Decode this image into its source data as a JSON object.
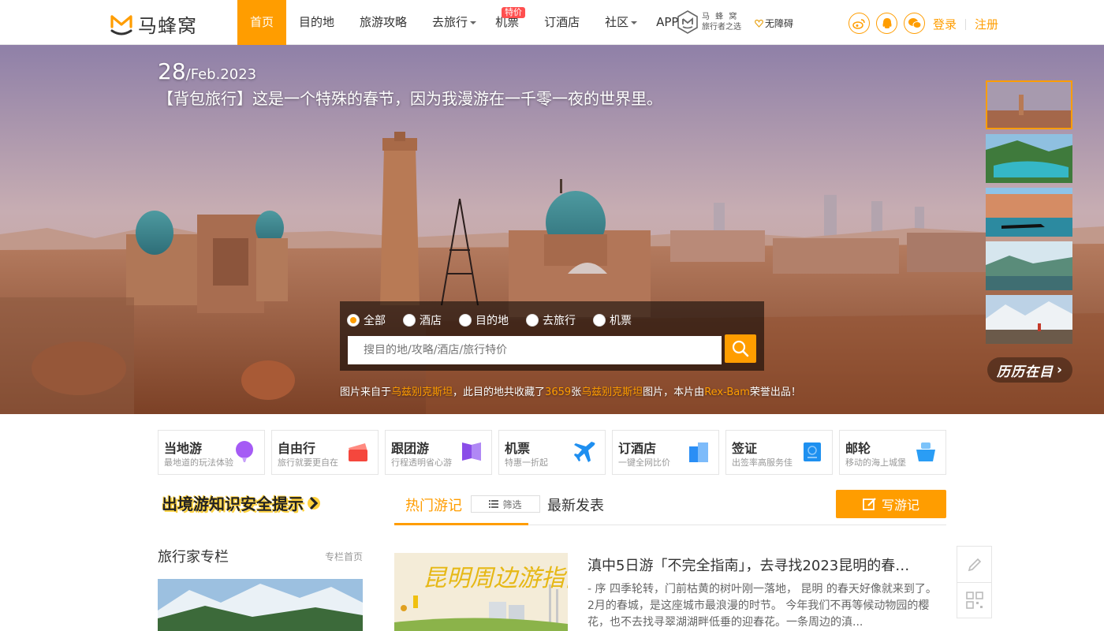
{
  "brand": {
    "name": "马蜂窝",
    "sub_line1": "马 蜂 窝",
    "sub_line2": "旅行者之选",
    "accessibility": "无障碍"
  },
  "nav": {
    "items": [
      {
        "label": "首页"
      },
      {
        "label": "目的地"
      },
      {
        "label": "旅游攻略"
      },
      {
        "label": "去旅行"
      },
      {
        "label": "机票",
        "badge": "特价"
      },
      {
        "label": "订酒店"
      },
      {
        "label": "社区"
      },
      {
        "label": "APP"
      }
    ]
  },
  "auth": {
    "login": "登录",
    "register": "注册"
  },
  "hero": {
    "day": "28",
    "month_year": "/Feb.2023",
    "title": "【背包旅行】这是一个特殊的春节，因为我漫游在一千零一夜的世界里。",
    "more_label": "历历在目"
  },
  "search": {
    "options": [
      {
        "label": "全部",
        "selected": true
      },
      {
        "label": "酒店",
        "selected": false
      },
      {
        "label": "目的地",
        "selected": false
      },
      {
        "label": "去旅行",
        "selected": false
      },
      {
        "label": "机票",
        "selected": false
      }
    ],
    "placeholder": "搜目的地/攻略/酒店/旅行特价"
  },
  "credit": {
    "prefix": "图片来自于",
    "place": "乌兹别克斯坦",
    "mid1": "，此目的地共收藏了",
    "count": "3659",
    "mid2": "张",
    "place2": "乌兹别克斯坦",
    "mid3": "图片，本片由",
    "author": "Rex-Bam",
    "suffix": "荣誉出品！"
  },
  "services": [
    {
      "title": "当地游",
      "sub": "最地道的玩法体验",
      "icon": "balloon-icon",
      "color": "#a55bf5"
    },
    {
      "title": "自由行",
      "sub": "旅行就要更自在",
      "icon": "ticket-icon",
      "color": "#f5473d"
    },
    {
      "title": "跟团游",
      "sub": "行程透明省心游",
      "icon": "flag-icon",
      "color": "#8a4de8"
    },
    {
      "title": "机票",
      "sub": "特惠一折起",
      "icon": "airplane-icon",
      "color": "#1f8ff0"
    },
    {
      "title": "订酒店",
      "sub": "一键全网比价",
      "icon": "hotel-icon",
      "color": "#2a8ef5"
    },
    {
      "title": "签证",
      "sub": "出签率高服务佳",
      "icon": "passport-icon",
      "color": "#1e90f0"
    },
    {
      "title": "邮轮",
      "sub": "移动的海上城堡",
      "icon": "cruise-icon",
      "color": "#2a9df5"
    }
  ],
  "left_col": {
    "safety_title": "出境游知识安全提示",
    "column_title": "旅行家专栏",
    "column_link": "专栏首页"
  },
  "feed": {
    "tab_hot": "热门游记",
    "filter": "筛选",
    "tab_new": "最新发表",
    "write": "写游记",
    "note": {
      "title": "滇中5日游「不完全指南」，去寻找2023昆明的春…",
      "summary": "- 序 四季轮转，门前枯黄的树叶刚一落地， 昆明 的春天好像就来到了。 2月的春城，是这座城市最浪漫的时节。 今年我们不再等候动物园的樱花，也不去找寻翠湖湖畔低垂的迎春花。一条周边的滇...",
      "image_text": "昆明周边游指南"
    }
  },
  "colors": {
    "accent": "#ff9d00",
    "badge_red": "#ff4f4f"
  }
}
